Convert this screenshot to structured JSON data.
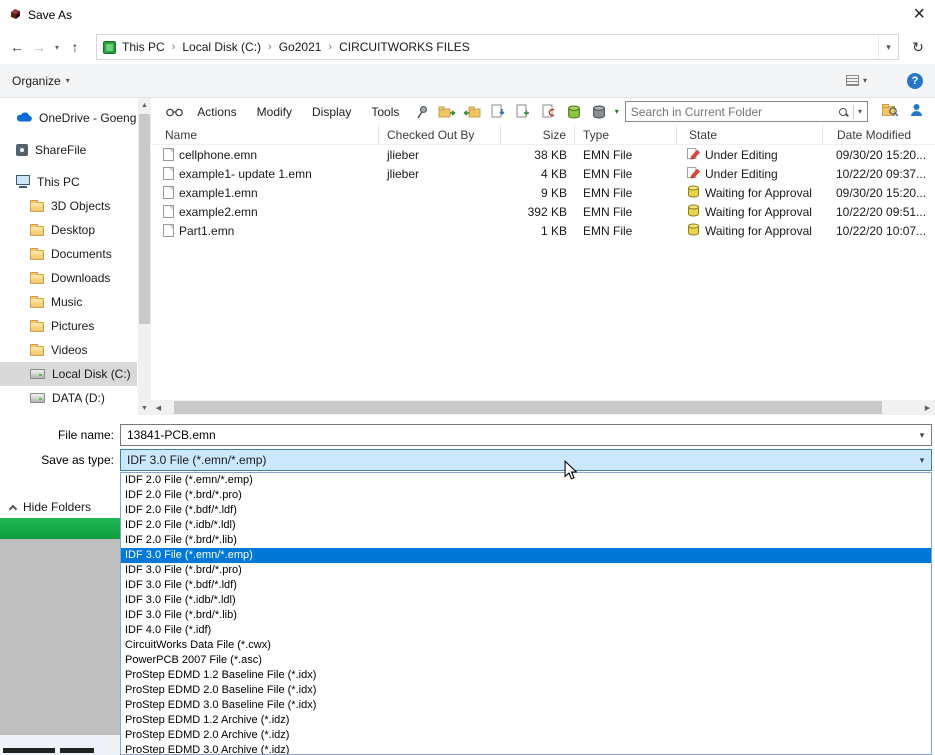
{
  "window": {
    "title": "Save As"
  },
  "nav": {
    "breadcrumb": [
      "This PC",
      "Local Disk (C:)",
      "Go2021",
      "CIRCUITWORKS FILES"
    ]
  },
  "organize_bar": {
    "organize_label": "Organize"
  },
  "sidebar": {
    "items": [
      "OneDrive - Goeng",
      "ShareFile",
      "This PC",
      "3D Objects",
      "Desktop",
      "Documents",
      "Downloads",
      "Music",
      "Pictures",
      "Videos",
      "Local Disk (C:)",
      "DATA (D:)"
    ],
    "selected_item": "Local Disk (C:)"
  },
  "cw_toolbar": {
    "menus": [
      "Actions",
      "Modify",
      "Display",
      "Tools"
    ],
    "search_placeholder": "Search in Current Folder"
  },
  "file_list": {
    "columns": [
      "Name",
      "Checked Out By",
      "Size",
      "Type",
      "State",
      "Date Modified"
    ],
    "rows": [
      {
        "name": "cellphone.emn",
        "checked_out_by": "jlieber",
        "size": "38 KB",
        "type": "EMN File",
        "state": "Under Editing",
        "date_modified": "09/30/20 15:20..."
      },
      {
        "name": "example1- update 1.emn",
        "checked_out_by": "jlieber",
        "size": "4 KB",
        "type": "EMN File",
        "state": "Under Editing",
        "date_modified": "10/22/20 09:37..."
      },
      {
        "name": "example1.emn",
        "checked_out_by": "",
        "size": "9 KB",
        "type": "EMN File",
        "state": "Waiting for Approval",
        "date_modified": "09/30/20 15:20..."
      },
      {
        "name": "example2.emn",
        "checked_out_by": "",
        "size": "392 KB",
        "type": "EMN File",
        "state": "Waiting for Approval",
        "date_modified": "10/22/20 09:51..."
      },
      {
        "name": "Part1.emn",
        "checked_out_by": "",
        "size": "1 KB",
        "type": "EMN File",
        "state": "Waiting for Approval",
        "date_modified": "10/22/20 10:07..."
      }
    ]
  },
  "form": {
    "file_name_label": "File name:",
    "file_name_value": "13841-PCB.emn",
    "save_as_type_label": "Save as type:",
    "save_as_type_value": "IDF 3.0 File (*.emn/*.emp)"
  },
  "type_dropdown": {
    "selected_index": 5,
    "options": [
      "IDF 2.0 File (*.emn/*.emp)",
      "IDF 2.0 File (*.brd/*.pro)",
      "IDF 2.0 File (*.bdf/*.ldf)",
      "IDF 2.0 File (*.idb/*.ldl)",
      "IDF 2.0 File (*.brd/*.lib)",
      "IDF 3.0 File (*.emn/*.emp)",
      "IDF 3.0 File (*.brd/*.pro)",
      "IDF 3.0 File (*.bdf/*.ldf)",
      "IDF 3.0 File (*.idb/*.ldl)",
      "IDF 3.0 File (*.brd/*.lib)",
      "IDF 4.0 File (*.idf)",
      "CircuitWorks Data File (*.cwx)",
      "PowerPCB 2007 File (*.asc)",
      "ProStep EDMD 1.2 Baseline File (*.idx)",
      "ProStep EDMD 2.0 Baseline File (*.idx)",
      "ProStep EDMD 3.0 Baseline File (*.idx)",
      "ProStep EDMD 1.2 Archive (*.idz)",
      "ProStep EDMD 2.0 Archive (*.idz)",
      "ProStep EDMD 3.0 Archive (*.idz)"
    ]
  },
  "footer": {
    "hide_folders_label": "Hide Folders"
  },
  "colors": {
    "selection_blue": "#0078d7",
    "combo_focus_bg": "#cce8ff",
    "progress_green": "#0f9c3f"
  }
}
